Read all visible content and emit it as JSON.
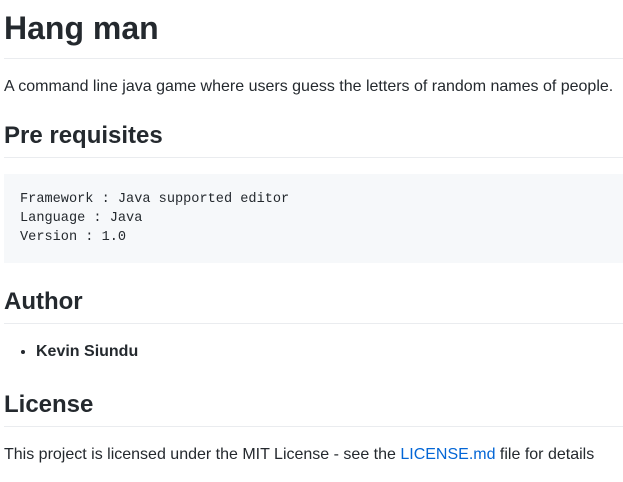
{
  "title": "Hang man",
  "description": "A command line java game where users guess the letters of random names of people.",
  "prereq": {
    "heading": "Pre requisites",
    "code": "Framework : Java supported editor\nLanguage : Java\nVersion : 1.0"
  },
  "author": {
    "heading": "Author",
    "items": [
      "Kevin Siundu"
    ]
  },
  "license": {
    "heading": "License",
    "text_before": "This project is licensed under the MIT License - see the ",
    "link": "LICENSE.md",
    "text_after": " file for details"
  }
}
